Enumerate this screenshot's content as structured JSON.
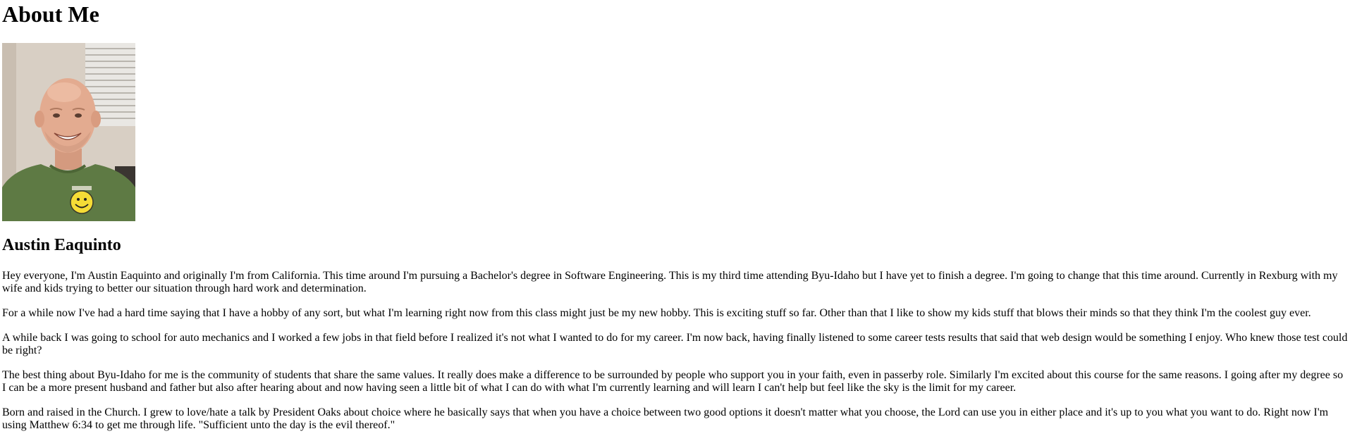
{
  "page": {
    "title": "About Me"
  },
  "profile": {
    "photo_icon": "profile-photo",
    "name": "Austin Eaquinto"
  },
  "bio": {
    "paragraphs": [
      "Hey everyone, I'm Austin Eaquinto and originally I'm from California. This time around I'm pursuing a Bachelor's degree in Software Engineering. This is my third time attending Byu-Idaho but I have yet to finish a degree. I'm going to change that this time around. Currently in Rexburg with my wife and kids trying to better our situation through hard work and determination.",
      "For a while now I've had a hard time saying that I have a hobby of any sort, but what I'm learning right now from this class might just be my new hobby. This is exciting stuff so far. Other than that I like to show my kids stuff that blows their minds so that they think I'm the coolest guy ever.",
      "A while back I was going to school for auto mechanics and I worked a few jobs in that field before I realized it's not what I wanted to do for my career. I'm now back, having finally listened to some career tests results that said that web design would be something I enjoy. Who knew those test could be right?",
      "The best thing about Byu-Idaho for me is the community of students that share the same values. It really does make a difference to be surrounded by people who support you in your faith, even in passerby role. Similarly I'm excited about this course for the same reasons. I going after my degree so I can be a more present husband and father but also after hearing about and now having seen a little bit of what I can do with what I'm currently learning and will learn I can't help but feel like the sky is the limit for my career.",
      "Born and raised in the Church. I grew to love/hate a talk by President Oaks about choice where he basically says that when you have a choice between two good options it doesn't matter what you choose, the Lord can use you in either place and it's up to you what you want to do. Right now I'm using Matthew 6:34 to get me through life. \"Sufficient unto the day is the evil thereof.\""
    ]
  }
}
